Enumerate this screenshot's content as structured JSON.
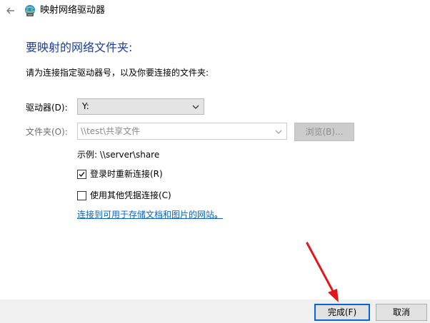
{
  "window": {
    "title": "映射网络驱动器",
    "back_icon": "back-arrow-icon",
    "app_icon": "network-drive-icon"
  },
  "main": {
    "heading": "要映射的网络文件夹:",
    "instruction": "请为连接指定驱动器号，以及你要连接的文件夹:",
    "drive_label": "驱动器(D):",
    "drive_value": "Y:",
    "folder_label": "文件夹(O):",
    "folder_value": "\\\\test\\共享文件",
    "browse_label": "浏览(B)...",
    "example": "示例: \\\\server\\share",
    "reconnect_label": "登录时重新连接(R)",
    "reconnect_checked": true,
    "credentials_label": "使用其他凭据连接(C)",
    "credentials_checked": false,
    "link_text": "连接到可用于存储文档和图片的网站",
    "link_suffix": "。"
  },
  "footer": {
    "finish_label": "完成(F)",
    "cancel_label": "取消"
  },
  "colors": {
    "heading": "#1b3d9c",
    "link": "#0b63c6",
    "accent_border": "#0a64d8",
    "annotation_arrow": "#e0161c"
  }
}
